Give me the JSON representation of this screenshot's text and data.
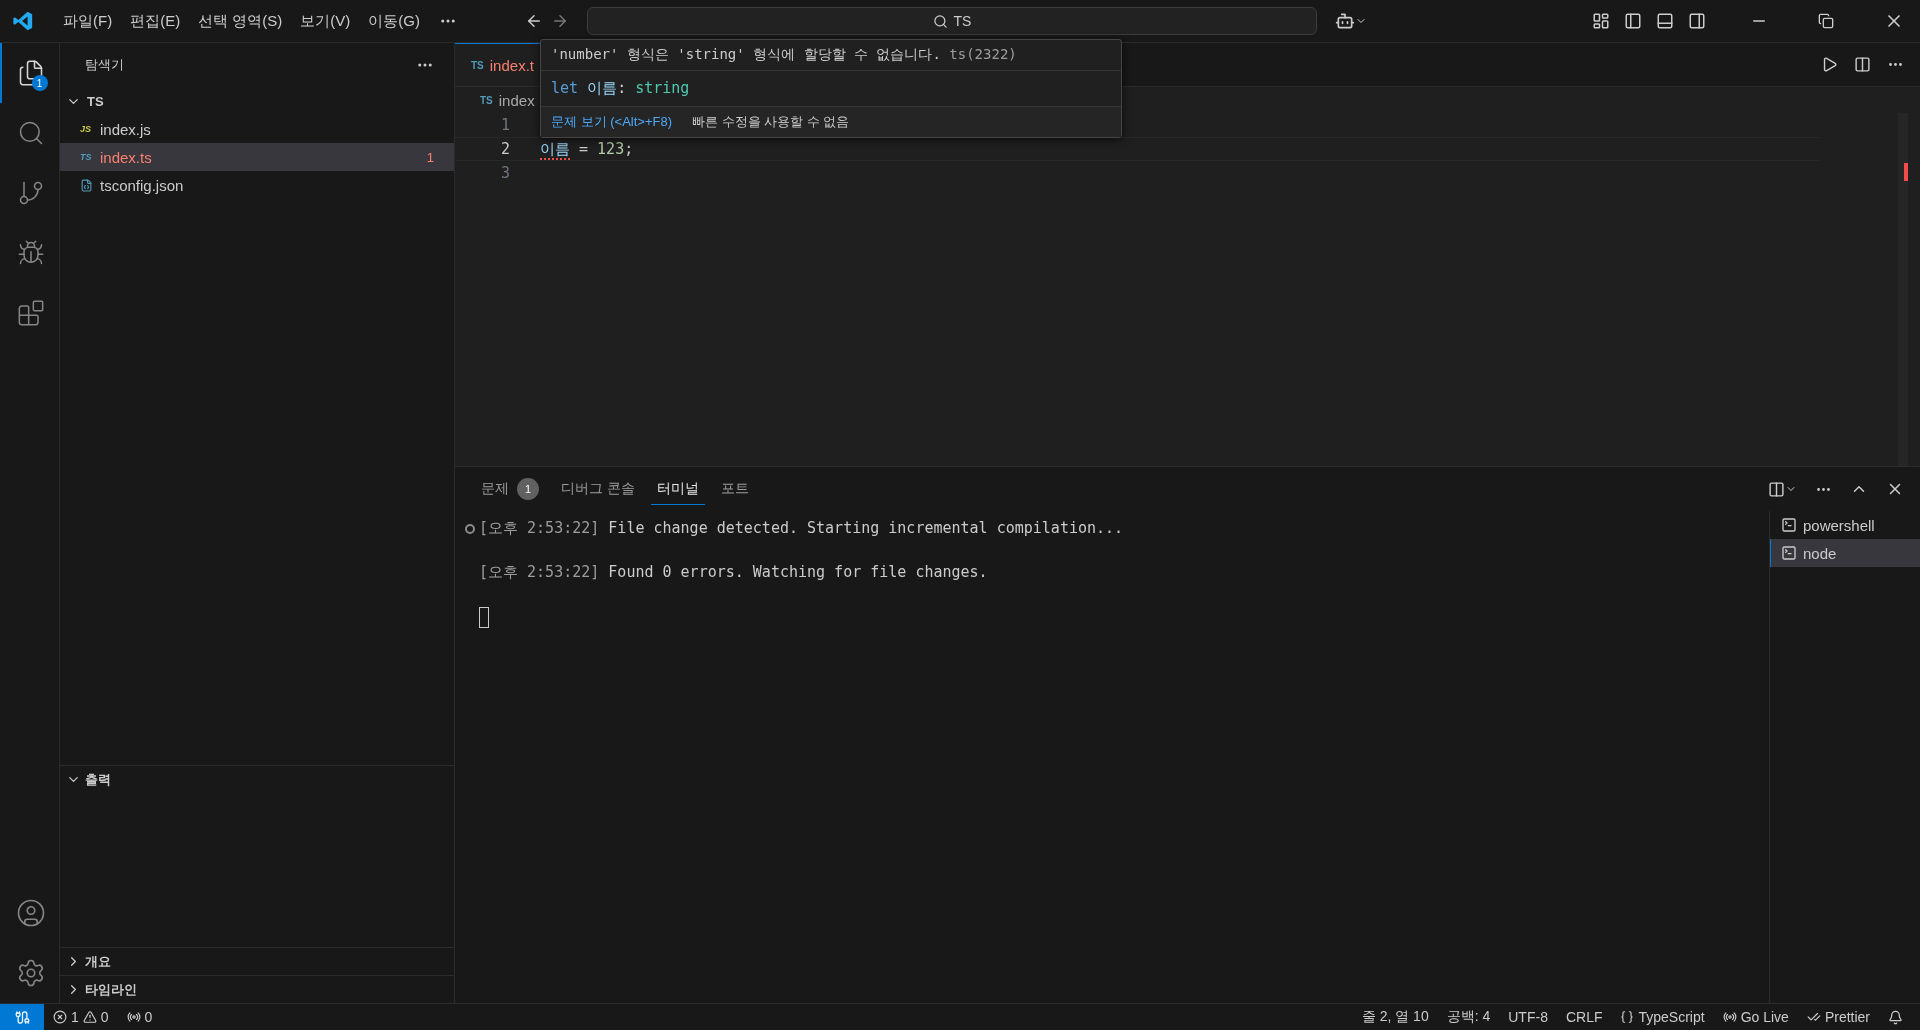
{
  "title_bar": {
    "menu": [
      "파일(F)",
      "편집(E)",
      "선택 영역(S)",
      "보기(V)",
      "이동(G)"
    ],
    "search": {
      "value": "TS"
    }
  },
  "activity_bar": {
    "items": [
      {
        "kind": "explorer",
        "selected": true,
        "badge": "1"
      },
      {
        "kind": "search",
        "selected": false
      },
      {
        "kind": "source-control",
        "selected": false
      },
      {
        "kind": "run",
        "selected": false
      },
      {
        "kind": "extensions",
        "selected": false
      }
    ]
  },
  "sidebar": {
    "title": "탐색기",
    "folder": {
      "name": "TS",
      "expanded": true,
      "files": [
        {
          "name": "index.js",
          "type_label": "JS",
          "kind": "js",
          "selected": false,
          "error": false
        },
        {
          "name": "index.ts",
          "type_label": "TS",
          "kind": "ts",
          "selected": true,
          "error": true,
          "badge": "1"
        },
        {
          "name": "tsconfig.json",
          "kind": "json",
          "selected": false,
          "error": false
        }
      ]
    },
    "sections": [
      {
        "title": "출력",
        "expanded": true
      },
      {
        "title": "개요",
        "expanded": false
      },
      {
        "title": "타임라인",
        "expanded": false
      }
    ]
  },
  "editor": {
    "tab": {
      "type_label": "TS",
      "label": "index.t"
    },
    "breadcrumb": {
      "type_label": "TS",
      "label": "index"
    },
    "lines": [
      {
        "number": "1",
        "current": false
      },
      {
        "number": "2",
        "current": true,
        "tokens": [
          {
            "text": "이름",
            "kind": "variable",
            "error": true
          },
          {
            "text": " = ",
            "kind": "plain",
            "error": false
          },
          {
            "text": "123",
            "kind": "number",
            "error": false
          },
          {
            "text": ";",
            "kind": "plain",
            "error": false
          }
        ]
      },
      {
        "number": "3",
        "current": false
      }
    ],
    "hover": {
      "message": "'number' 형식은 'string' 형식에 할당할 수 없습니다.",
      "code": "ts(2322)",
      "signature": [
        {
          "text": "let",
          "kind": "keyword"
        },
        {
          "text": " 이름",
          "kind": "variable"
        },
        {
          "text": ": ",
          "kind": "plain"
        },
        {
          "text": "string",
          "kind": "type"
        }
      ],
      "link": "문제 보기 (<Alt>+F8)",
      "note": "빠른 수정을 사용할 수 없음"
    }
  },
  "panel": {
    "tabs": [
      {
        "label": "문제",
        "badge": "1",
        "selected": false
      },
      {
        "label": "디버그 콘솔",
        "selected": false
      },
      {
        "label": "터미널",
        "selected": true
      },
      {
        "label": "포트",
        "selected": false
      }
    ],
    "terminal": [
      {
        "time": "[오후 2:53:22]",
        "text": " File change detected. Starting incremental compilation...",
        "marker": true
      },
      {
        "time": "[오후 2:53:22]",
        "text": " Found 0 errors. Watching for file changes.",
        "marker": false
      }
    ],
    "sessions": [
      {
        "name": "powershell",
        "selected": false
      },
      {
        "name": "node",
        "selected": true
      }
    ]
  },
  "status_bar": {
    "errors": "1",
    "warnings": "0",
    "ports": "0",
    "right": [
      {
        "text": "줄 2, 열 10",
        "kind": "text"
      },
      {
        "text": "공백: 4",
        "kind": "text"
      },
      {
        "text": "UTF-8",
        "kind": "text"
      },
      {
        "text": "CRLF",
        "kind": "text"
      },
      {
        "text": "TypeScript",
        "kind": "language"
      },
      {
        "text": "Go Live",
        "kind": "live"
      },
      {
        "text": "Prettier",
        "kind": "formatter"
      }
    ]
  }
}
